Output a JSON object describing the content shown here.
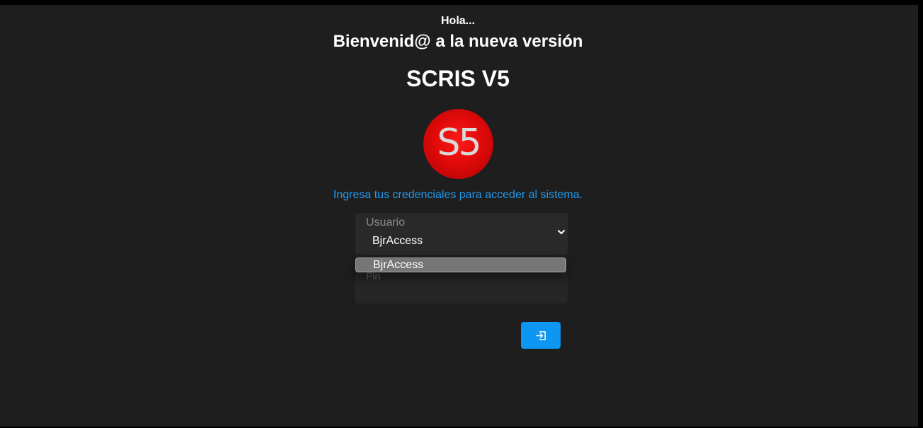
{
  "header": {
    "greeting": "Hola...",
    "welcome": "Bienvenid@ a la nueva versión",
    "product_name": "SCRIS V5"
  },
  "logo": {
    "text": "S5",
    "color": "#e10a0a"
  },
  "subtitle": "Ingresa tus credenciales para acceder al sistema.",
  "form": {
    "user_field": {
      "label": "Usuario",
      "value": "BjrAccess",
      "icon": "chevron-down-icon"
    },
    "user_dropdown": {
      "options": [
        "BjrAccess"
      ]
    },
    "pin_field": {
      "label": "Pin"
    },
    "login_button": {
      "icon": "login-icon",
      "color": "#0d96f2"
    }
  },
  "colors": {
    "background": "#1e1e1e",
    "accent_text": "#1e9bf0"
  }
}
